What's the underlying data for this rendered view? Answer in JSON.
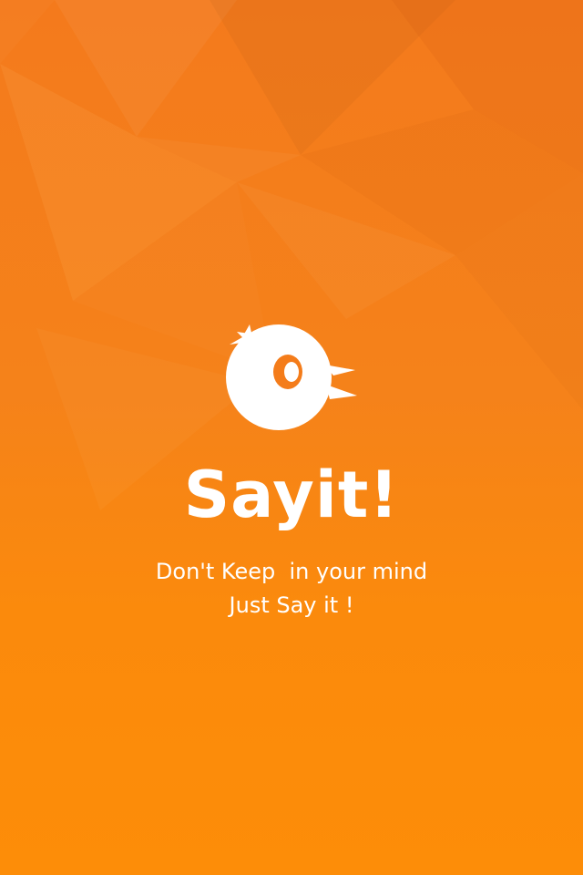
{
  "app": {
    "name": "Sayit!",
    "tagline_line1": "Don't Keep  in your mind",
    "tagline_line2": "Just Say it !"
  },
  "logo": {
    "icon": "bird-mascot-icon"
  },
  "colors": {
    "background_top": "#f47a1c",
    "background_bottom": "#fd8d08",
    "logo": "#ffffff",
    "text": "#ffffff"
  }
}
